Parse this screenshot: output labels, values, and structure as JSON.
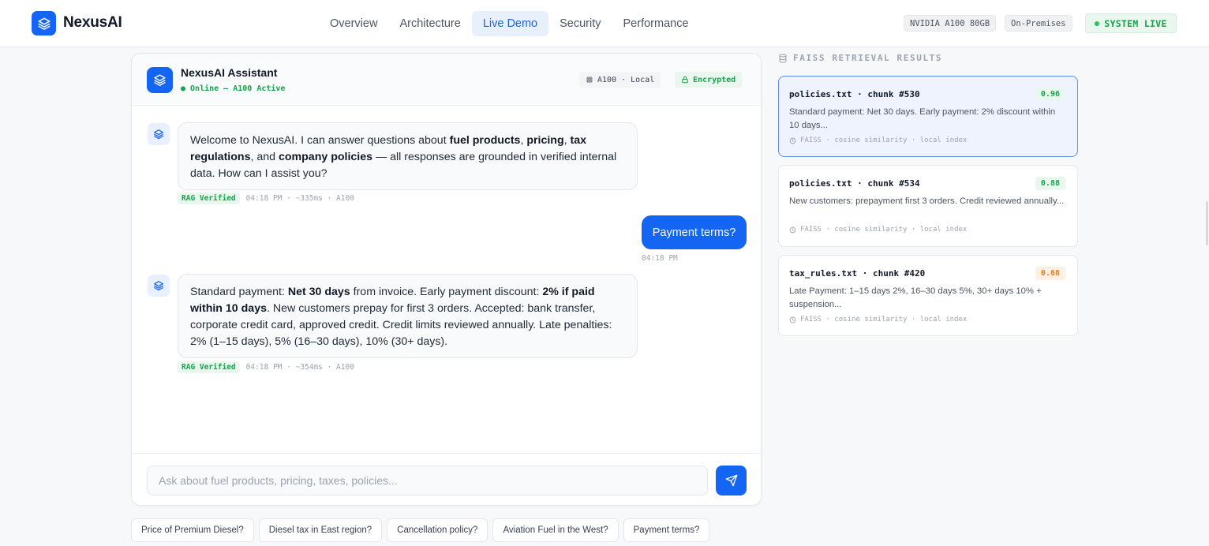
{
  "header": {
    "brand": "NexusAI",
    "nav": [
      {
        "label": "Overview"
      },
      {
        "label": "Architecture"
      },
      {
        "label": "Live Demo"
      },
      {
        "label": "Security"
      },
      {
        "label": "Performance"
      }
    ],
    "active_nav": "Live Demo",
    "gpu_badge": "NVIDIA A100 80GB",
    "deploy_badge": "On-Premises",
    "status_badge": "SYSTEM LIVE"
  },
  "chat": {
    "assistant_name": "NexusAI Assistant",
    "assistant_status": "● Online — A100 Active",
    "hw_badge": "A100 · Local",
    "enc_badge": "Encrypted",
    "messages": [
      {
        "role": "assistant",
        "parts": [
          {
            "t": "Welcome to NexusAI. I can answer questions about "
          },
          {
            "t": "fuel products",
            "b": true
          },
          {
            "t": ", "
          },
          {
            "t": "pricing",
            "b": true
          },
          {
            "t": ", "
          },
          {
            "t": "tax regulations",
            "b": true
          },
          {
            "t": ", and "
          },
          {
            "t": "company policies",
            "b": true
          },
          {
            "t": " — all responses are grounded in verified internal data. How can I assist you?"
          }
        ],
        "tag": "RAG Verified",
        "meta": "04:18 PM · ~335ms · A100"
      },
      {
        "role": "user",
        "text": "Payment terms?",
        "meta": "04:18 PM"
      },
      {
        "role": "assistant",
        "parts": [
          {
            "t": "Standard payment: "
          },
          {
            "t": "Net 30 days",
            "b": true
          },
          {
            "t": " from invoice. Early payment discount: "
          },
          {
            "t": "2% if paid within 10 days",
            "b": true
          },
          {
            "t": ". New customers prepay for first 3 orders. Accepted: bank transfer, corporate credit card, approved credit. Credit limits reviewed annually. Late penalties: 2% (1–15 days), 5% (16–30 days), 10% (30+ days)."
          }
        ],
        "tag": "RAG Verified",
        "meta": "04:18 PM · ~354ms · A100"
      }
    ],
    "input_placeholder": "Ask about fuel products, pricing, taxes, policies..."
  },
  "suggestions": [
    "Price of Premium Diesel?",
    "Diesel tax in East region?",
    "Cancellation policy?",
    "Aviation Fuel in the West?",
    "Payment terms?"
  ],
  "retrieval": {
    "title": "FAISS RETRIEVAL RESULTS",
    "results": [
      {
        "file": "policies.txt · chunk #530",
        "score": "0.96",
        "text": "Standard payment: Net 30 days. Early payment: 2% discount within 10 days...",
        "footer": "FAISS · cosine similarity · local index"
      },
      {
        "file": "policies.txt · chunk #534",
        "score": "0.88",
        "text": "New customers: prepayment first 3 orders. Credit reviewed annually...",
        "footer": "FAISS · cosine similarity · local index"
      },
      {
        "file": "tax_rules.txt · chunk #420",
        "score": "0.68",
        "text": "Late Payment: 1–15 days 2%, 16–30 days 5%, 30+ days 10% + suspension...",
        "footer": "FAISS · cosine similarity · local index"
      }
    ]
  },
  "colors": {
    "primary": "#1565f5",
    "success": "#16a34a",
    "warning": "#ea7a1a"
  },
  "icons": {
    "logo": "layers-icon",
    "hardware": "chip-icon",
    "encrypted": "lock-icon",
    "send": "send-icon",
    "database": "database-icon",
    "clock": "clock-icon"
  }
}
